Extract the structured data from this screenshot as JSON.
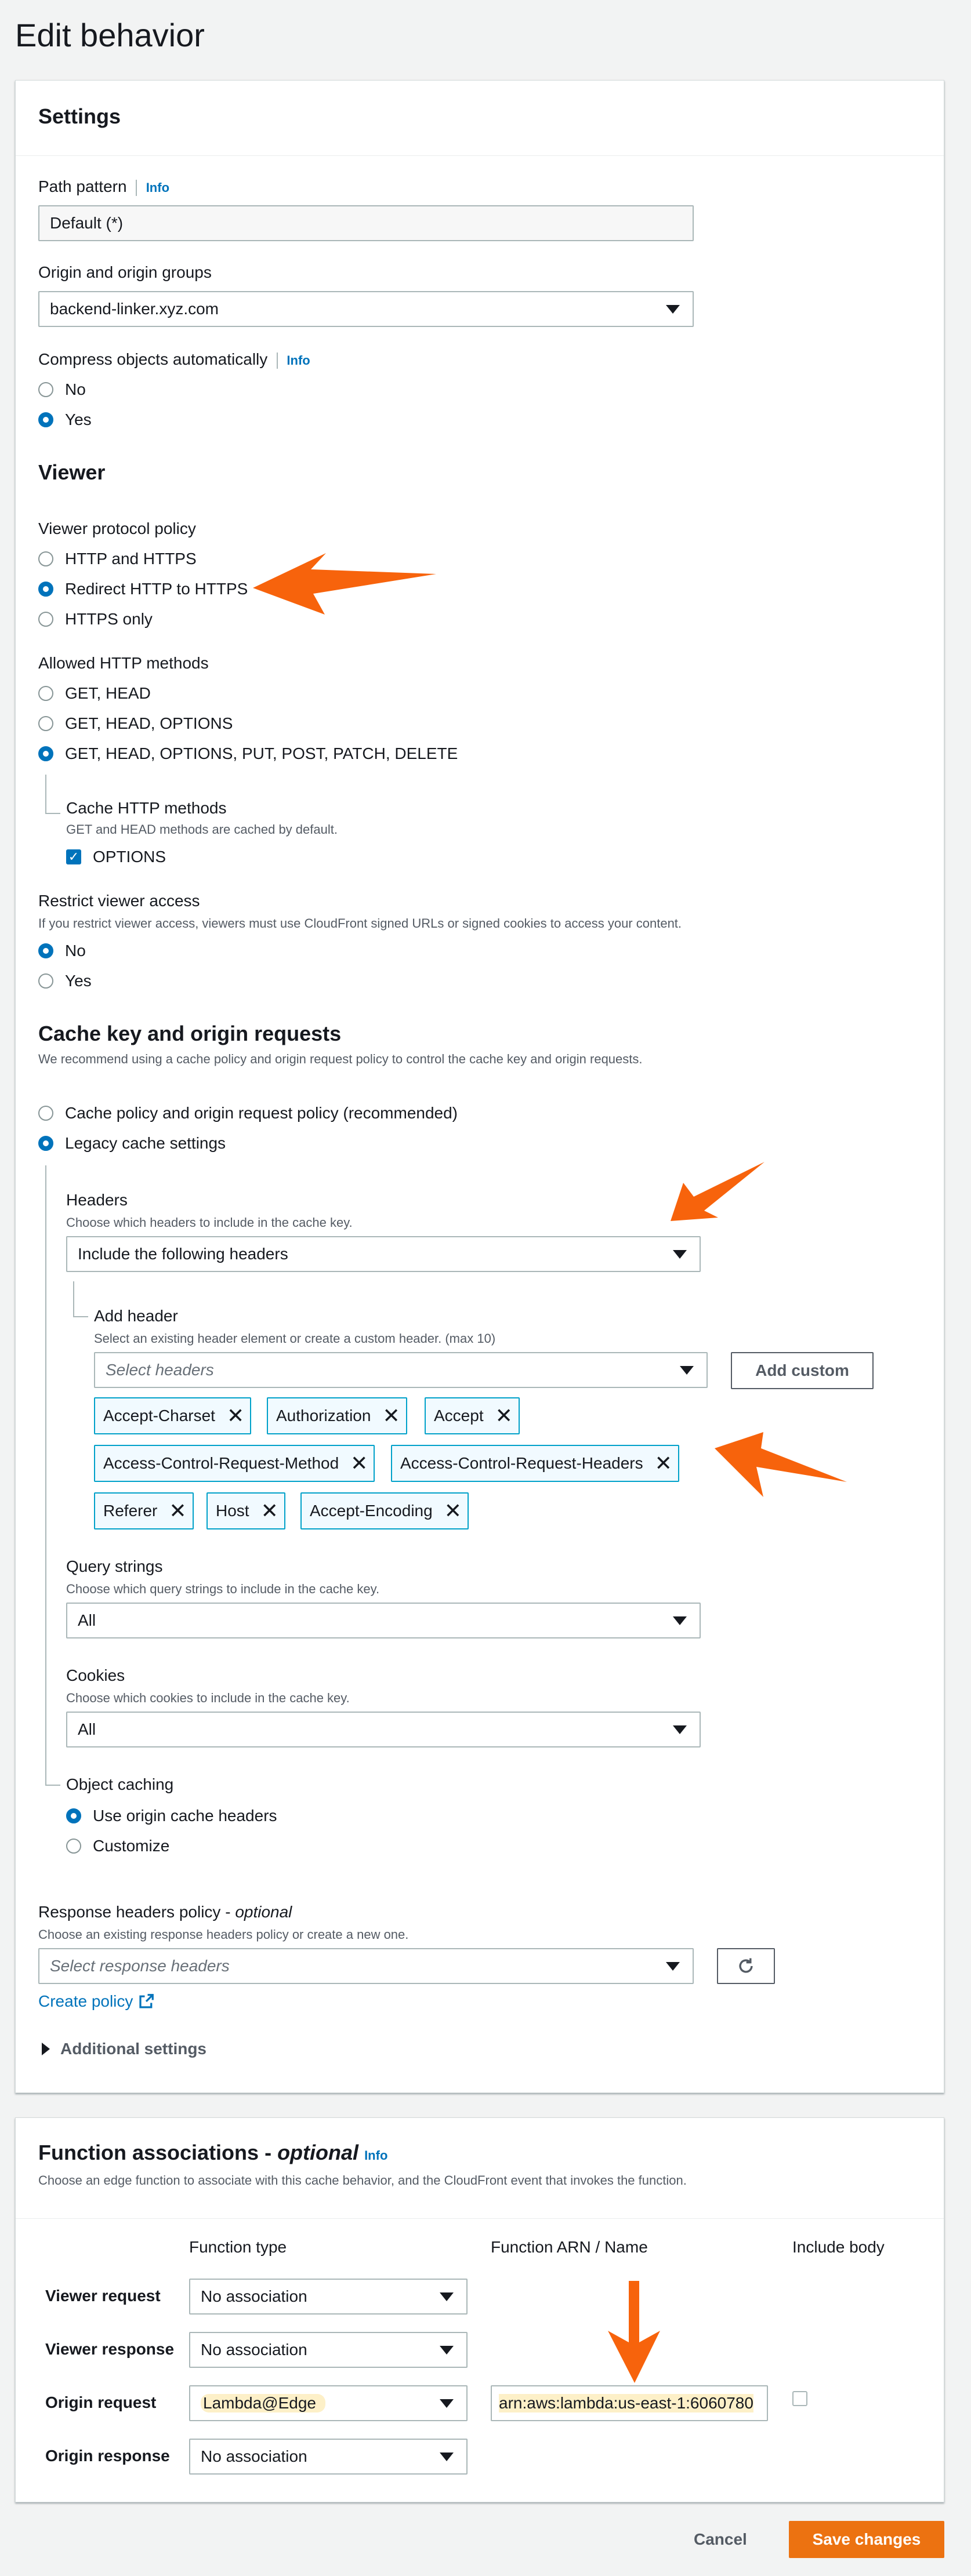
{
  "page": {
    "title": "Edit behavior"
  },
  "settings": {
    "title": "Settings",
    "path_pattern": {
      "label": "Path pattern",
      "info": "Info",
      "value": "Default (*)"
    },
    "origin": {
      "label": "Origin and origin groups",
      "value": "backend-linker.xyz.com"
    },
    "compress": {
      "label": "Compress objects automatically",
      "info": "Info",
      "options": [
        "No",
        "Yes"
      ],
      "selected": "Yes"
    }
  },
  "viewer": {
    "title": "Viewer",
    "protocol": {
      "label": "Viewer protocol policy",
      "options": [
        "HTTP and HTTPS",
        "Redirect HTTP to HTTPS",
        "HTTPS only"
      ],
      "selected": "Redirect HTTP to HTTPS"
    },
    "methods": {
      "label": "Allowed HTTP methods",
      "options": [
        "GET, HEAD",
        "GET, HEAD, OPTIONS",
        "GET, HEAD, OPTIONS, PUT, POST, PATCH, DELETE"
      ],
      "selected": "GET, HEAD, OPTIONS, PUT, POST, PATCH, DELETE"
    },
    "cache_methods": {
      "label": "Cache HTTP methods",
      "desc": "GET and HEAD methods are cached by default.",
      "option": "OPTIONS",
      "checked": true
    },
    "restrict": {
      "label": "Restrict viewer access",
      "desc": "If you restrict viewer access, viewers must use CloudFront signed URLs or signed cookies to access your content.",
      "options": [
        "No",
        "Yes"
      ],
      "selected": "No"
    }
  },
  "cache": {
    "title": "Cache key and origin requests",
    "desc": "We recommend using a cache policy and origin request policy to control the cache key and origin requests.",
    "options": [
      "Cache policy and origin request policy (recommended)",
      "Legacy cache settings"
    ],
    "selected": "Legacy cache settings",
    "headers": {
      "label": "Headers",
      "desc": "Choose which headers to include in the cache key.",
      "value": "Include the following headers"
    },
    "add_header": {
      "label": "Add header",
      "desc": "Select an existing header element or create a custom header. (max 10)",
      "placeholder": "Select headers",
      "add_custom": "Add custom"
    },
    "tokens": [
      "Accept-Charset",
      "Authorization",
      "Accept",
      "Access-Control-Request-Method",
      "Access-Control-Request-Headers",
      "Referer",
      "Host",
      "Accept-Encoding"
    ],
    "query": {
      "label": "Query strings",
      "desc": "Choose which query strings to include in the cache key.",
      "value": "All"
    },
    "cookies": {
      "label": "Cookies",
      "desc": "Choose which cookies to include in the cache key.",
      "value": "All"
    },
    "object_caching": {
      "label": "Object caching",
      "options": [
        "Use origin cache headers",
        "Customize"
      ],
      "selected": "Use origin cache headers"
    },
    "response_policy": {
      "label": "Response headers policy",
      "optional": "optional",
      "desc": "Choose an existing response headers policy or create a new one.",
      "placeholder": "Select response headers",
      "create": "Create policy"
    },
    "additional": "Additional settings"
  },
  "functions": {
    "title": "Function associations",
    "optional": "optional",
    "info": "Info",
    "desc": "Choose an edge function to associate with this cache behavior, and the CloudFront event that invokes the function.",
    "columns": [
      "Function type",
      "Function ARN / Name",
      "Include body"
    ],
    "rows": [
      {
        "label": "Viewer request",
        "type": "No association"
      },
      {
        "label": "Viewer response",
        "type": "No association"
      },
      {
        "label": "Origin request",
        "type": "Lambda@Edge",
        "arn": "arn:aws:lambda:us-east-1:6060780"
      },
      {
        "label": "Origin response",
        "type": "No association"
      }
    ]
  },
  "footer": {
    "cancel": "Cancel",
    "save": "Save changes"
  },
  "colors": {
    "accent": "#0073bb",
    "primary": "#ec7211",
    "arrow": "#f7630c",
    "token_border": "#00a1c9",
    "highlight": "#fdf0c8"
  }
}
